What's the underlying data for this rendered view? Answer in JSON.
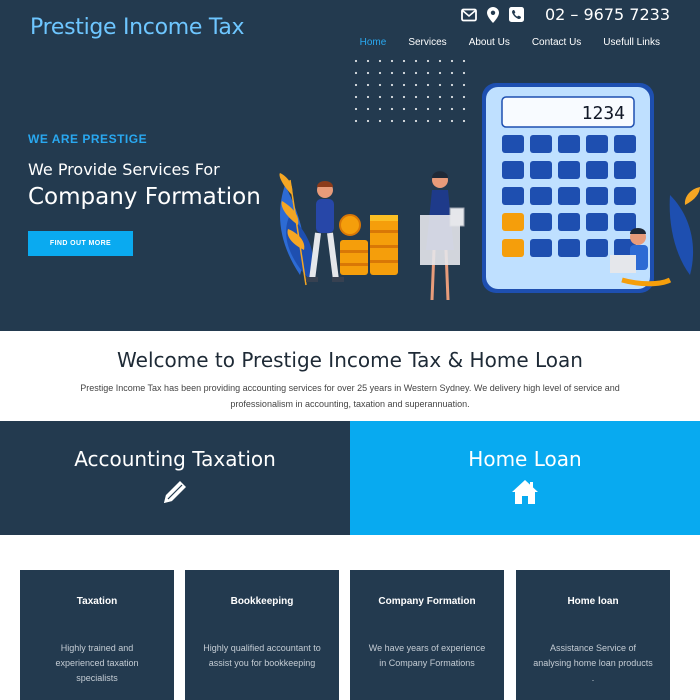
{
  "header": {
    "logo": "Prestige Income Tax",
    "phone": "02 – 9675 7233",
    "icons": [
      "envelope-icon",
      "map-pin-icon",
      "phone-icon"
    ]
  },
  "nav": {
    "items": [
      {
        "label": "Home",
        "active": true
      },
      {
        "label": "Services",
        "active": false
      },
      {
        "label": "About Us",
        "active": false
      },
      {
        "label": "Contact Us",
        "active": false
      },
      {
        "label": "Usefull Links",
        "active": false
      }
    ]
  },
  "hero": {
    "eyebrow": "WE ARE PRESTIGE",
    "subtitle": "We Provide Services For",
    "headline": "Company Formation",
    "cta": "FIND OUT MORE",
    "calculator_display": "1234"
  },
  "welcome": {
    "title": "Welcome to Prestige Income Tax & Home Loan",
    "text": "Prestige Income Tax has been providing accounting services for over 25 years in Western Sydney. We delivery high level of service and professionalism in accounting, taxation and superannuation."
  },
  "split": {
    "left": {
      "title": "Accounting Taxation",
      "icon": "pencil-icon"
    },
    "right": {
      "title": "Home Loan",
      "icon": "house-icon"
    }
  },
  "cards": [
    {
      "title": "Taxation",
      "text": "Highly trained and experienced taxation specialists"
    },
    {
      "title": "Bookkeeping",
      "text": "Highly qualified accountant  to assist you for bookkeeping"
    },
    {
      "title": "Company Formation",
      "text": "We have years of experience in Company Formations"
    },
    {
      "title": "Home loan",
      "text": "Assistance  Service of analysing home loan products ."
    }
  ],
  "colors": {
    "navy": "#233a4f",
    "accent": "#08aaf0",
    "logo": "#6ec6ff"
  }
}
